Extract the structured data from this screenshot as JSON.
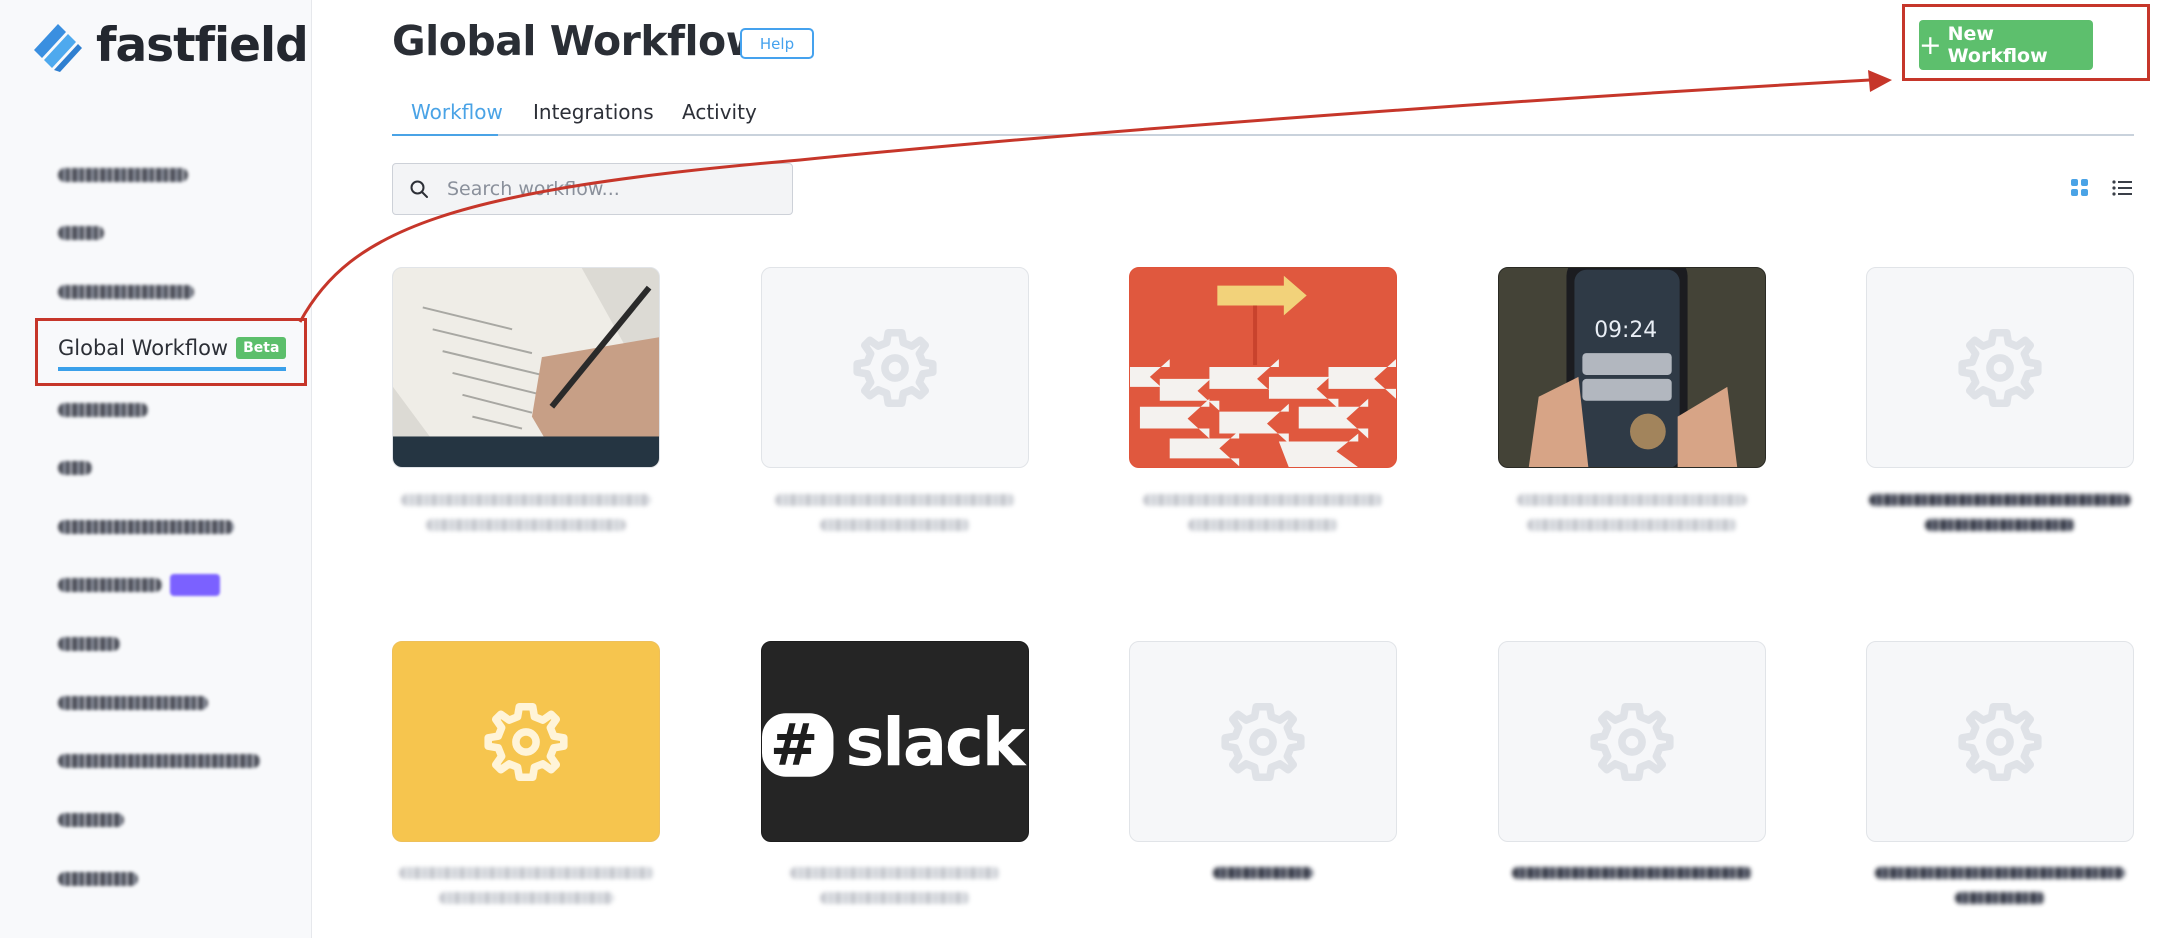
{
  "brand": {
    "name": "fastfield"
  },
  "page": {
    "title": "Global Workflow",
    "help_label": "Help",
    "new_workflow_label": "New Workflow"
  },
  "tabs": [
    {
      "label": "Workflow",
      "active": true
    },
    {
      "label": "Integrations",
      "active": false
    },
    {
      "label": "Activity",
      "active": false
    }
  ],
  "search": {
    "placeholder": "Search workflow..."
  },
  "sidebar": {
    "active_item": {
      "label": "Global Workflow",
      "badge": "Beta"
    }
  },
  "cards": [
    {
      "image": "notebook-checklist-photo"
    },
    {
      "image": "gear-placeholder"
    },
    {
      "image": "red-arrows-photo"
    },
    {
      "image": "phone-notification-photo"
    },
    {
      "image": "gear-placeholder"
    },
    {
      "image": "gear-on-yellow"
    },
    {
      "image": "slack-logo",
      "logo_text": "slack"
    },
    {
      "image": "gear-placeholder"
    },
    {
      "image": "gear-placeholder"
    },
    {
      "image": "gear-placeholder"
    }
  ],
  "colors": {
    "accent_blue": "#4aa3e6",
    "new_button_green": "#5dbf6d",
    "beta_badge_green": "#5cbf6b",
    "annotation_red": "#c6362a",
    "yellow_card": "#f6c54e"
  }
}
